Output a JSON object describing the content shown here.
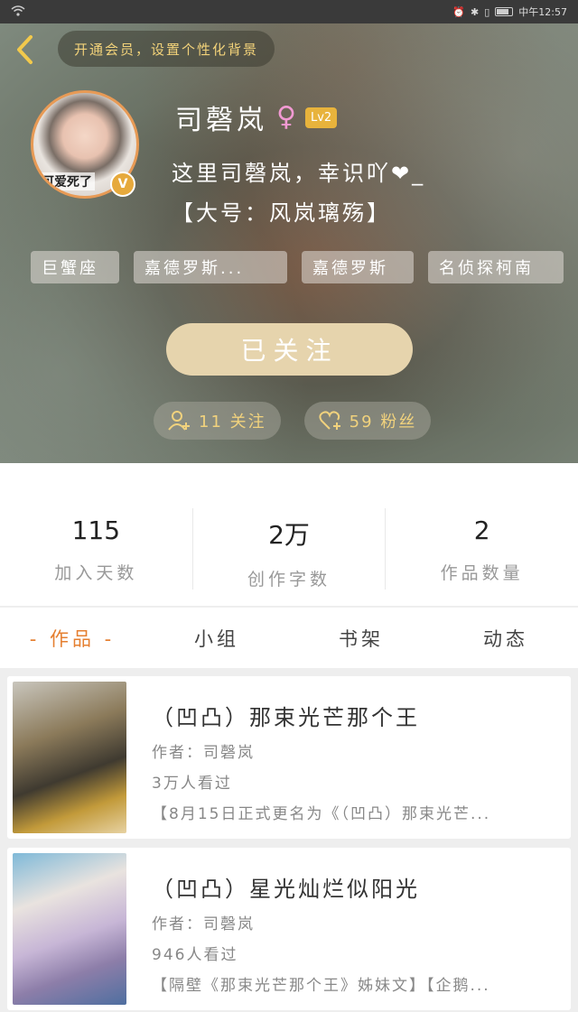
{
  "status_bar": {
    "time": "中午12:57"
  },
  "header": {
    "vip_banner": "开通会员，设置个性化背景",
    "avatar_caption": "可爱死了",
    "name": "司磬岚",
    "gender_symbol": "♀",
    "level": "Lv2",
    "bio_line1": "这里司磬岚，幸识吖❤_",
    "bio_line2": "【大号：风岚璃殇】",
    "tags": [
      "巨蟹座",
      "嘉德罗斯...",
      "嘉德罗斯",
      "名侦探柯南"
    ],
    "follow_button": "已关注",
    "following": "11 关注",
    "fans": "59 粉丝"
  },
  "stats": [
    {
      "value": "115",
      "label": "加入天数"
    },
    {
      "value": "2万",
      "label": "创作字数"
    },
    {
      "value": "2",
      "label": "作品数量"
    }
  ],
  "tabs": [
    "- 作品 -",
    "小组",
    "书架",
    "动态"
  ],
  "works": [
    {
      "title": "（凹凸）那束光芒那个王",
      "author": "作者：司磬岚",
      "views": "3万人看过",
      "desc": "【8月15日正式更名为《（凹凸）那束光芒..."
    },
    {
      "title": "（凹凸）星光灿烂似阳光",
      "author": "作者：司磬岚",
      "views": "946人看过",
      "desc": "【隔壁《那束光芒那个王》姊妹文】【企鹅..."
    }
  ],
  "colors": {
    "accent": "#e57f30",
    "gold": "#f2d27a",
    "follow_bg": "#e6d4ad"
  }
}
